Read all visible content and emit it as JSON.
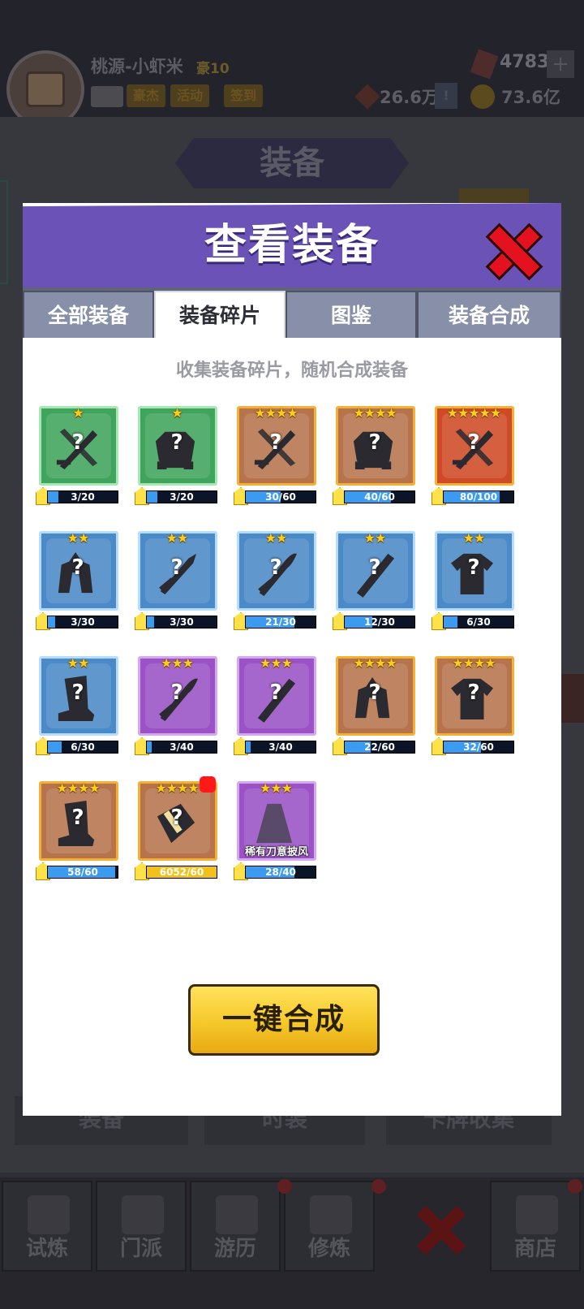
{
  "background": {
    "player_name": "桃源-小虾米",
    "vip_label": "豪10",
    "header_tags": [
      "豪杰",
      "活动",
      "签到"
    ],
    "gems": "4783",
    "rubies": "26.6万",
    "coins": "73.6亿",
    "page_banner": "装备",
    "bottom_tabs": [
      "装备",
      "时装",
      "卡牌收集"
    ],
    "nav_items": [
      "试炼",
      "门派",
      "游历",
      "修炼",
      "商店"
    ]
  },
  "modal": {
    "title": "查看装备",
    "tabs": [
      "全部装备",
      "装备碎片",
      "图鉴",
      "装备合成"
    ],
    "active_tab": "装备碎片",
    "hint": "收集装备碎片，随机合成装备",
    "synth_button": "一键合成",
    "fragments": [
      {
        "rarity": "green",
        "stars": "★",
        "icon": "swords-icon",
        "current": 3,
        "total": 20,
        "progress": "3/20"
      },
      {
        "rarity": "green",
        "stars": "★",
        "icon": "armor-icon",
        "current": 3,
        "total": 20,
        "progress": "3/20"
      },
      {
        "rarity": "orange",
        "stars": "★★★★",
        "icon": "swords-icon",
        "current": 30,
        "total": 60,
        "progress": "30/60"
      },
      {
        "rarity": "orange",
        "stars": "★★★★",
        "icon": "armor-icon",
        "current": 40,
        "total": 60,
        "progress": "40/60"
      },
      {
        "rarity": "red",
        "stars": "★★★★★",
        "icon": "swords-icon",
        "current": 80,
        "total": 100,
        "progress": "80/100"
      },
      {
        "rarity": "blue",
        "stars": "★★",
        "icon": "helmet-icon",
        "current": 3,
        "total": 30,
        "progress": "3/30"
      },
      {
        "rarity": "blue",
        "stars": "★★",
        "icon": "sword-icon",
        "current": 3,
        "total": 30,
        "progress": "3/30"
      },
      {
        "rarity": "blue",
        "stars": "★★",
        "icon": "saber-icon",
        "current": 21,
        "total": 30,
        "progress": "21/30"
      },
      {
        "rarity": "blue",
        "stars": "★★",
        "icon": "staff-icon",
        "current": 12,
        "total": 30,
        "progress": "12/30"
      },
      {
        "rarity": "blue",
        "stars": "★★",
        "icon": "robe-icon",
        "current": 6,
        "total": 30,
        "progress": "6/30"
      },
      {
        "rarity": "blue",
        "stars": "★★",
        "icon": "boot-icon",
        "current": 6,
        "total": 30,
        "progress": "6/30"
      },
      {
        "rarity": "purple",
        "stars": "★★★",
        "icon": "saber-icon",
        "current": 3,
        "total": 40,
        "progress": "3/40"
      },
      {
        "rarity": "purple",
        "stars": "★★★",
        "icon": "staff-icon",
        "current": 3,
        "total": 40,
        "progress": "3/40"
      },
      {
        "rarity": "orange",
        "stars": "★★★★",
        "icon": "helmet-icon",
        "current": 22,
        "total": 60,
        "progress": "22/60"
      },
      {
        "rarity": "orange",
        "stars": "★★★★",
        "icon": "robe-icon",
        "current": 32,
        "total": 60,
        "progress": "32/60"
      },
      {
        "rarity": "orange",
        "stars": "★★★★",
        "icon": "boot-icon",
        "current": 58,
        "total": 60,
        "progress": "58/60"
      },
      {
        "rarity": "orange",
        "stars": "★★★★",
        "icon": "bracer-icon",
        "current": 6052,
        "total": 60,
        "progress": "6052/60",
        "full": true,
        "notify": true
      },
      {
        "rarity": "purple",
        "stars": "★★★",
        "icon": "cloak-icon",
        "current": 28,
        "total": 40,
        "progress": "28/40",
        "label": "稀有刀意披风",
        "revealed": true
      }
    ]
  }
}
